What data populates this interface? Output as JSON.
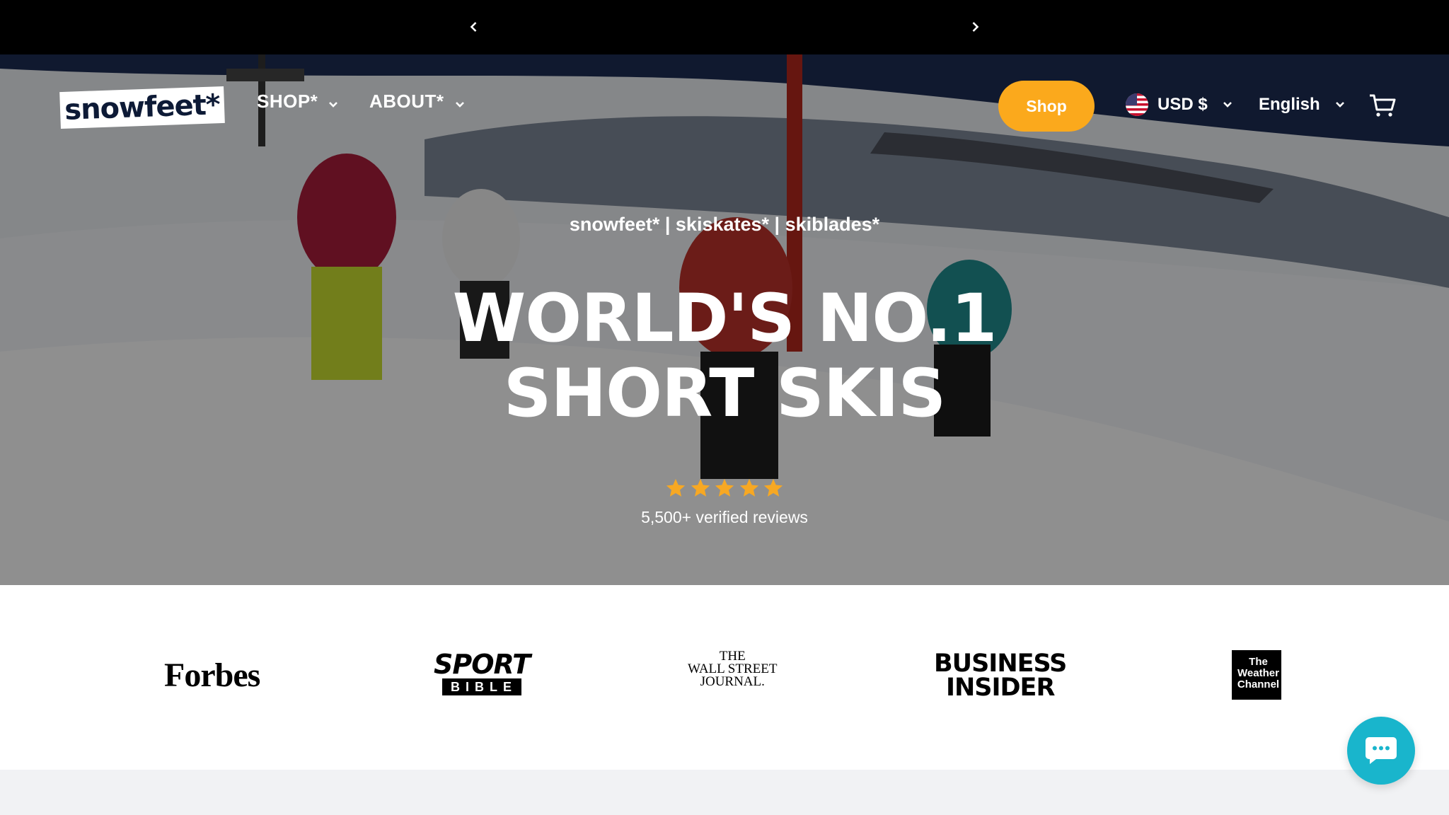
{
  "announcement_bar": {
    "prev_icon": "chevron-left-icon",
    "next_icon": "chevron-right-icon"
  },
  "header": {
    "logo_text": "snowfeet*",
    "nav": [
      {
        "label": "SHOP*",
        "icon": "chevron-down-icon"
      },
      {
        "label": "ABOUT*",
        "icon": "chevron-down-icon"
      }
    ],
    "shop_button": "Shop",
    "currency": {
      "label": "USD $",
      "flag_icon": "us-flag-icon"
    },
    "language": {
      "label": "English"
    },
    "cart_icon": "cart-icon"
  },
  "hero": {
    "tagline": "snowfeet* | skiskates* | skiblades*",
    "headline_line1": "WORLD'S NO.1",
    "headline_line2": "SHORT SKIS",
    "rating_stars": 5,
    "reviews": "5,500+ verified reviews"
  },
  "press": {
    "forbes": "Forbes",
    "sport_bible_top": "SPORT",
    "sport_bible_bottom": "BIBLE",
    "wsj_line1": "THE",
    "wsj_line2": "WALL STREET",
    "wsj_line3": "JOURNAL.",
    "bi_line1": "BUSINESS",
    "bi_line2": "INSIDER",
    "twc_line1": "The",
    "twc_line2": "Weather",
    "twc_line3": "Channel"
  },
  "chat_icon": "chat-bubble-icon",
  "colors": {
    "accent": "#fba91c",
    "chat": "#19b5cc",
    "star": "#f7a823",
    "logo_text": "#0d1a36"
  }
}
